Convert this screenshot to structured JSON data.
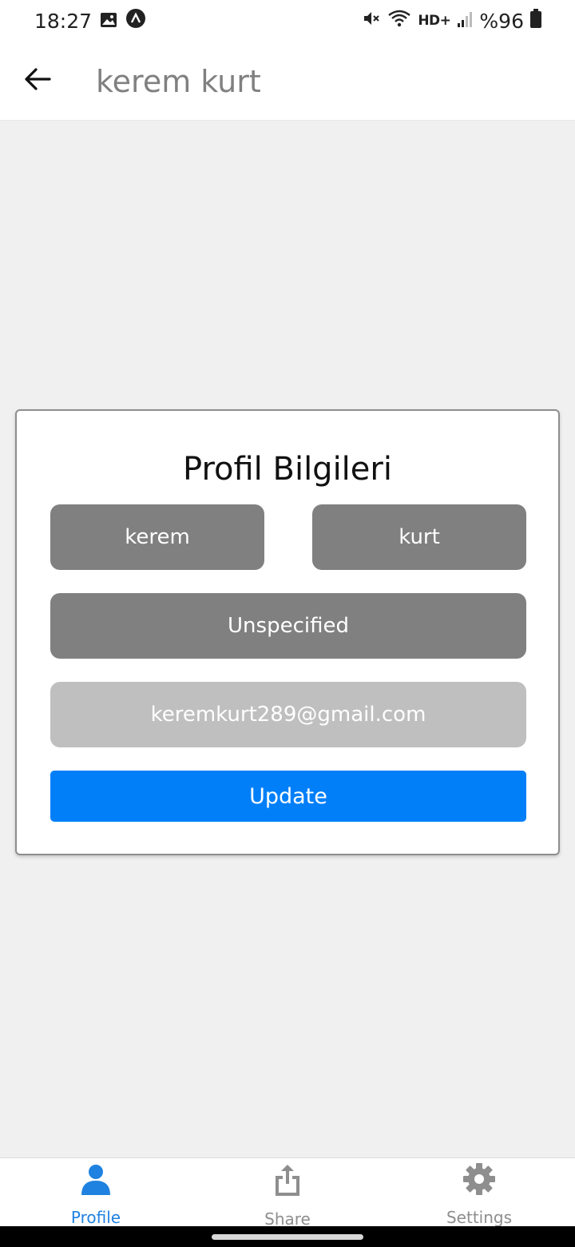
{
  "status_bar": {
    "time": "18:27",
    "network": "HD+",
    "battery": "%96",
    "icons": [
      "image-icon",
      "app-notification-icon",
      "mute-icon",
      "wifi-icon",
      "signal-icon",
      "battery-icon"
    ]
  },
  "app_bar": {
    "title": "kerem kurt",
    "back_icon": "arrow-left-icon"
  },
  "card": {
    "title": "Profil Bilgileri",
    "first_name": "kerem",
    "last_name": "kurt",
    "gender": "Unspecified",
    "email": "keremkurt289@gmail.com",
    "update_label": "Update"
  },
  "tabs": [
    {
      "label": "Profile",
      "icon": "person-icon",
      "active": true
    },
    {
      "label": "Share",
      "icon": "share-icon",
      "active": false
    },
    {
      "label": "Settings",
      "icon": "gear-icon",
      "active": false
    }
  ],
  "colors": {
    "accent": "#007ff9",
    "active_tab": "#1f82e0",
    "field_dark": "#808080",
    "field_light": "#c0bfc0",
    "background": "#f0f0f0"
  }
}
